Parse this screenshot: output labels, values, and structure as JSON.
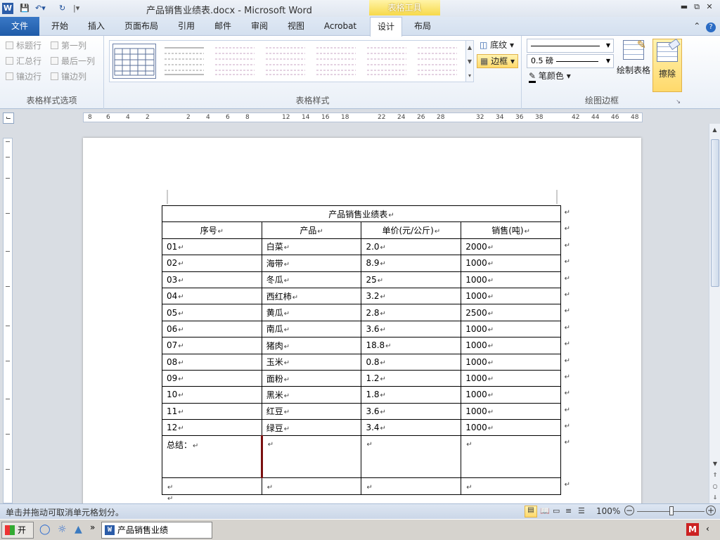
{
  "window": {
    "title": "产品销售业绩表.docx  -  Microsoft Word",
    "contextual_tab_group": "表格工具"
  },
  "tabs": [
    {
      "label": "文件"
    },
    {
      "label": "开始"
    },
    {
      "label": "插入"
    },
    {
      "label": "页面布局"
    },
    {
      "label": "引用"
    },
    {
      "label": "邮件"
    },
    {
      "label": "审阅"
    },
    {
      "label": "视图"
    },
    {
      "label": "Acrobat"
    },
    {
      "label": "设计"
    },
    {
      "label": "布局"
    }
  ],
  "active_tab": "设计",
  "ribbon": {
    "style_options": {
      "label": "表格样式选项",
      "options": [
        "标题行",
        "第一列",
        "汇总行",
        "最后一列",
        "镶边行",
        "镶边列"
      ]
    },
    "table_styles": {
      "label": "表格样式"
    },
    "shading_label": "底纹",
    "borders_label": "边框",
    "pen_weight": "0.5 磅",
    "pen_color_label": "笔颜色",
    "draw_table_label": "绘制表格",
    "eraser_label": "擦除",
    "draw_borders_group_label": "绘图边框"
  },
  "ruler": {
    "h_ticks": [
      "8",
      "6",
      "4",
      "2",
      "2",
      "4",
      "6",
      "8",
      "12",
      "14",
      "16",
      "18",
      "22",
      "24",
      "26",
      "28",
      "32",
      "34",
      "36",
      "38",
      "42",
      "44",
      "46",
      "48"
    ]
  },
  "document": {
    "table_title": "产品销售业绩表",
    "headers": [
      "序号",
      "产品",
      "单价(元/公斤)",
      "销售(吨)"
    ],
    "rows": [
      [
        "01",
        "白菜",
        "2.0",
        "2000"
      ],
      [
        "02",
        "海带",
        "8.9",
        "1000"
      ],
      [
        "03",
        "冬瓜",
        "25",
        "1000"
      ],
      [
        "04",
        "西红柿",
        "3.2",
        "1000"
      ],
      [
        "05",
        "黄瓜",
        "2.8",
        "2500"
      ],
      [
        "06",
        "南瓜",
        "3.6",
        "1000"
      ],
      [
        "07",
        "猪肉",
        "18.8",
        "1000"
      ],
      [
        "08",
        "玉米",
        "0.8",
        "1000"
      ],
      [
        "09",
        "面粉",
        "1.2",
        "1000"
      ],
      [
        "10",
        "黑米",
        "1.8",
        "1000"
      ],
      [
        "11",
        "红豆",
        "3.6",
        "1000"
      ],
      [
        "12",
        "绿豆",
        "3.4",
        "1000"
      ]
    ],
    "summary_label": "总结："
  },
  "status": {
    "message": "单击并拖动可取消单元格划分。",
    "zoom": "100%"
  },
  "taskbar": {
    "start": "开始",
    "item": "产品销售业绩表.docx..."
  }
}
